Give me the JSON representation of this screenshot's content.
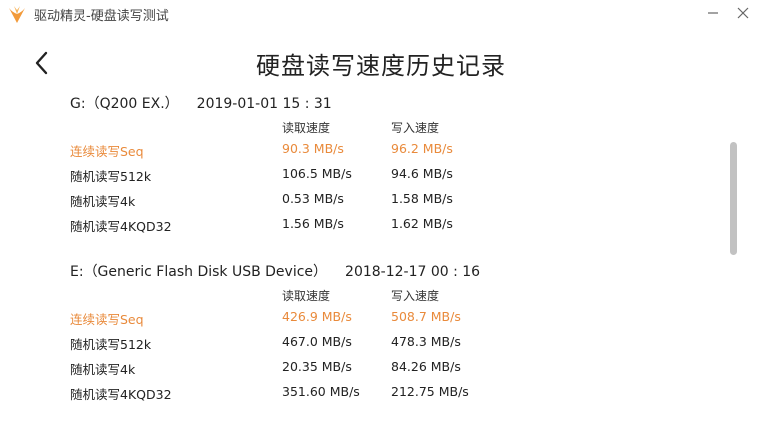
{
  "app_title": "驱动精灵-硬盘读写测试",
  "page_title": "硬盘读写速度历史记录",
  "columns": {
    "read": "读取速度",
    "write": "写入速度"
  },
  "accent_color": "#e98a3b",
  "records": [
    {
      "drive": "G:（Q200 EX.）",
      "datetime": "2019-01-01  15 : 31",
      "rows": [
        {
          "label": "连续读写Seq",
          "read": "90.3 MB/s",
          "write": "96.2 MB/s"
        },
        {
          "label": "随机读写512k",
          "read": "106.5 MB/s",
          "write": "94.6 MB/s"
        },
        {
          "label": "随机读写4k",
          "read": "0.53 MB/s",
          "write": "1.58 MB/s"
        },
        {
          "label": "随机读写4KQD32",
          "read": "1.56 MB/s",
          "write": "1.62 MB/s"
        }
      ]
    },
    {
      "drive": "E:（Generic Flash Disk USB Device）",
      "datetime": "2018-12-17  00 : 16",
      "rows": [
        {
          "label": "连续读写Seq",
          "read": "426.9 MB/s",
          "write": "508.7 MB/s"
        },
        {
          "label": "随机读写512k",
          "read": "467.0 MB/s",
          "write": "478.3 MB/s"
        },
        {
          "label": "随机读写4k",
          "read": "20.35 MB/s",
          "write": "84.26 MB/s"
        },
        {
          "label": "随机读写4KQD32",
          "read": "351.60 MB/s",
          "write": "212.75 MB/s"
        }
      ]
    }
  ],
  "icons": {
    "logo": "app-logo-icon",
    "minimize": "minimize-icon",
    "close": "close-icon",
    "back": "back-arrow-icon"
  }
}
